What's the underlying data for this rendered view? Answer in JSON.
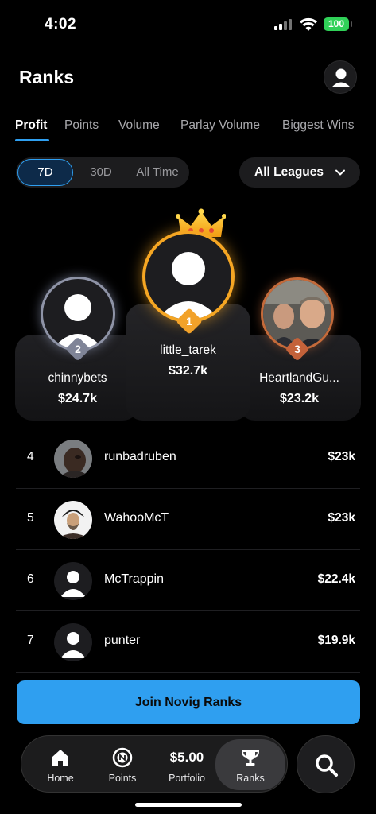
{
  "status_bar": {
    "time": "4:02",
    "battery": "100"
  },
  "header": {
    "title": "Ranks"
  },
  "tabs": [
    {
      "label": "Profit",
      "active": true
    },
    {
      "label": "Points"
    },
    {
      "label": "Volume"
    },
    {
      "label": "Parlay Volume"
    },
    {
      "label": "Biggest Wins"
    }
  ],
  "time_filter": {
    "options": [
      "7D",
      "30D",
      "All Time"
    ],
    "selected": "7D"
  },
  "league_filter": {
    "label": "All Leagues"
  },
  "podium": [
    {
      "rank": "1",
      "name": "little_tarek",
      "amount": "$32.7k"
    },
    {
      "rank": "2",
      "name": "chinnybets",
      "amount": "$24.7k"
    },
    {
      "rank": "3",
      "name": "HeartlandGu...",
      "amount": "$23.2k"
    }
  ],
  "list": [
    {
      "rank": "4",
      "name": "runbadruben",
      "amount": "$23k"
    },
    {
      "rank": "5",
      "name": "WahooMcT",
      "amount": "$23k"
    },
    {
      "rank": "6",
      "name": "McTrappin",
      "amount": "$22.4k"
    },
    {
      "rank": "7",
      "name": "punter",
      "amount": "$19.9k"
    }
  ],
  "join_button": {
    "label": "Join Novig Ranks"
  },
  "bottom_nav": {
    "home": "Home",
    "points": "Points",
    "portfolio_value": "$5.00",
    "portfolio": "Portfolio",
    "ranks": "Ranks"
  },
  "colors": {
    "accent": "#2f9ff0",
    "gold": "#f5a623",
    "silver": "#8e93a6",
    "bronze": "#c46a3a",
    "battery": "#30d158"
  },
  "icons": [
    "signal-icon",
    "wifi-icon",
    "battery-icon",
    "profile-icon",
    "chevron-down-icon",
    "crown-icon",
    "home-icon",
    "points-icon",
    "trophy-icon",
    "search-icon"
  ]
}
